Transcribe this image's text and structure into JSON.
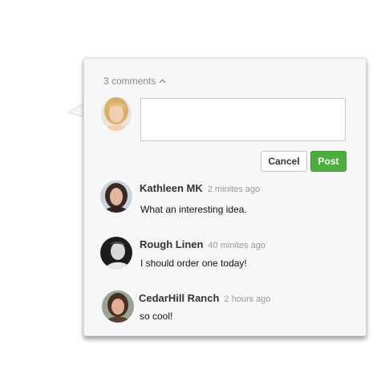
{
  "header": {
    "comments_count_label": "3 comments"
  },
  "composer": {
    "placeholder": "",
    "value": "",
    "cancel_label": "Cancel",
    "post_label": "Post"
  },
  "comments": [
    {
      "author": "Kathleen MK",
      "time": "2 minites ago",
      "text": "What an interesting idea."
    },
    {
      "author": "Rough Linen",
      "time": "40 minites ago",
      "text": "I should order one today!"
    },
    {
      "author": "CedarHill Ranch",
      "time": "2 hours ago",
      "text": "so cool!"
    }
  ],
  "colors": {
    "post_button": "#4cae3c",
    "panel_bg": "#f7f7f7",
    "meta_text": "#999999"
  }
}
